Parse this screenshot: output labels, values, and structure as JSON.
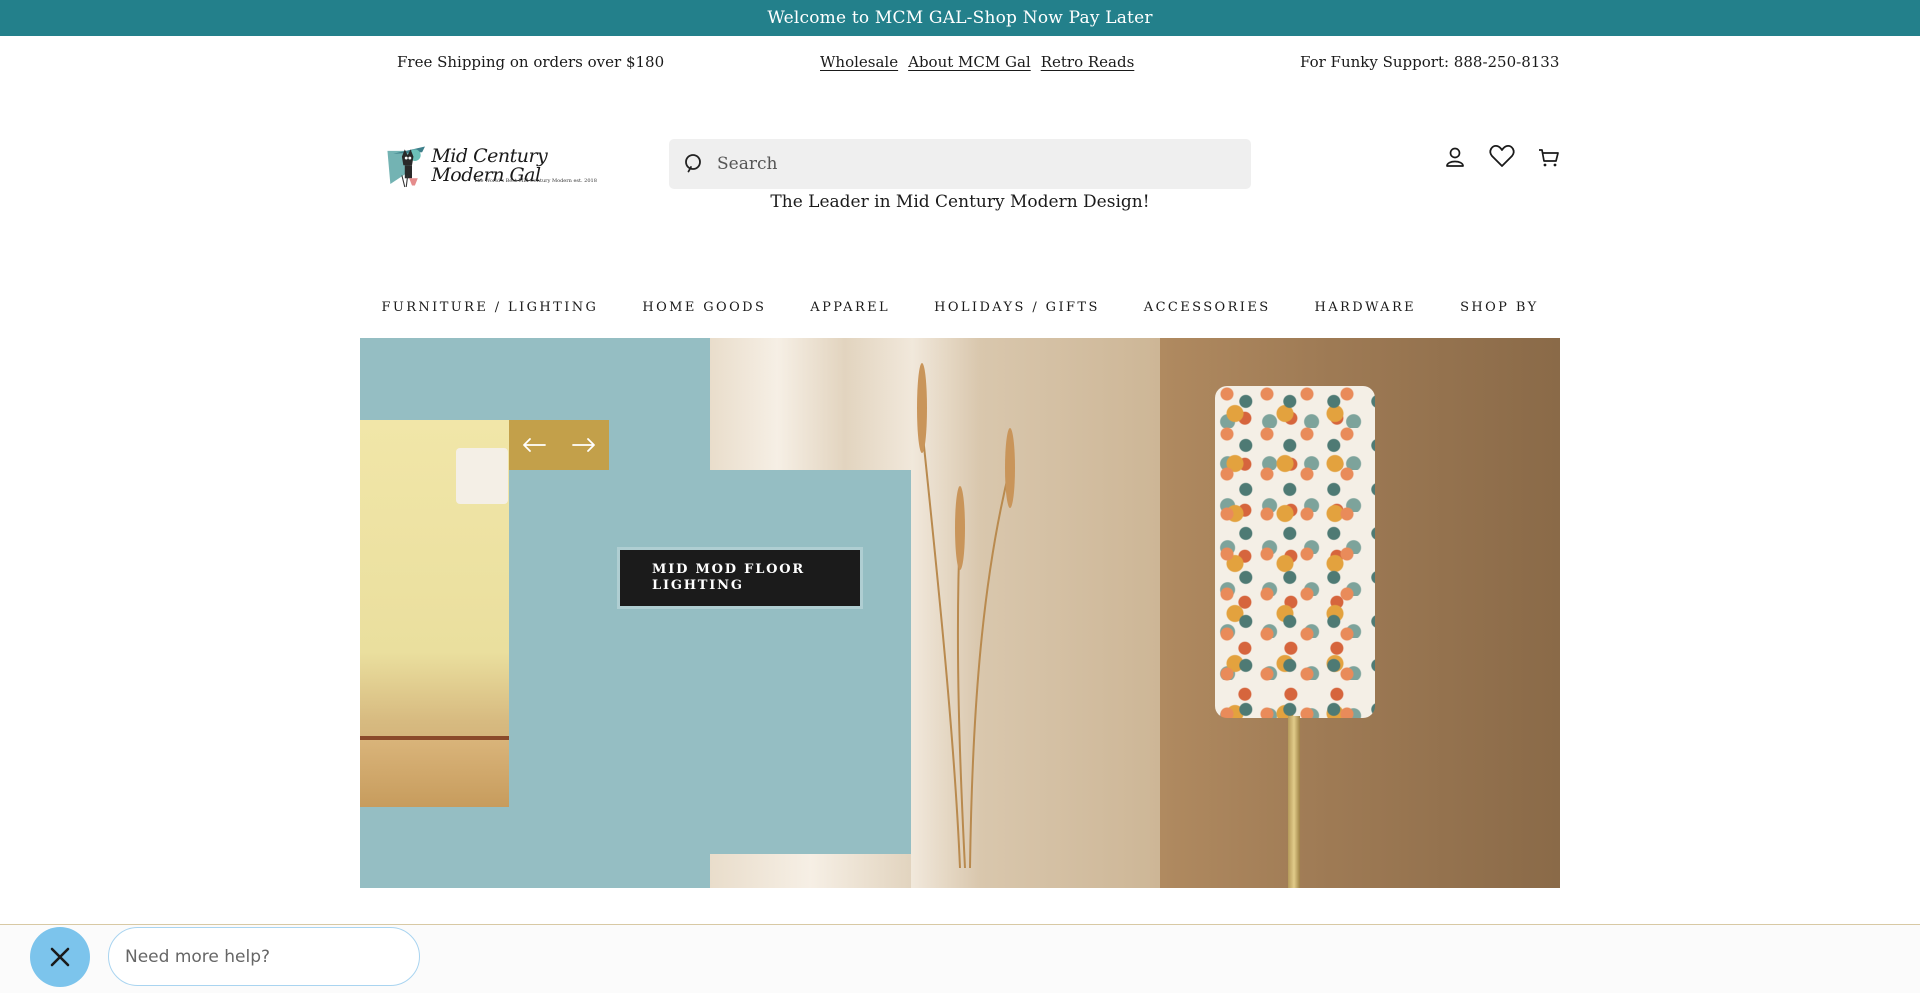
{
  "announcement": "Welcome to MCM GAL-Shop Now Pay Later",
  "utility": {
    "shipping": "Free Shipping on orders over $180",
    "links": [
      "Wholesale",
      "About MCM Gal",
      "Retro Reads"
    ],
    "support": "For Funky Support: 888-250-8133"
  },
  "logo": {
    "wordmark": "Mid Century Modern Gal",
    "tagline": "The World's Best Mid Century Modern est. 2018"
  },
  "search": {
    "placeholder": "Search",
    "icon": "search-icon"
  },
  "tagline": "The Leader in Mid Century Modern Design!",
  "header_icons": [
    "account-icon",
    "heart-icon",
    "cart-icon"
  ],
  "nav": [
    "FURNITURE / LIGHTING",
    "HOME GOODS",
    "APPAREL",
    "HOLIDAYS / GIFTS",
    "ACCESSORIES",
    "HARDWARE",
    "SHOP BY"
  ],
  "hero": {
    "cta_label": "MID MOD FLOOR LIGHTING",
    "arrows": [
      "arrow-left-icon",
      "arrow-right-icon"
    ]
  },
  "chat": {
    "placeholder": "Need more help?",
    "close_icon": "close-icon"
  },
  "colors": {
    "accent": "#23808b",
    "hero_bg": "#95bec3",
    "arrow_bg": "#c3a04a",
    "cta_bg": "#1b1b1b"
  }
}
